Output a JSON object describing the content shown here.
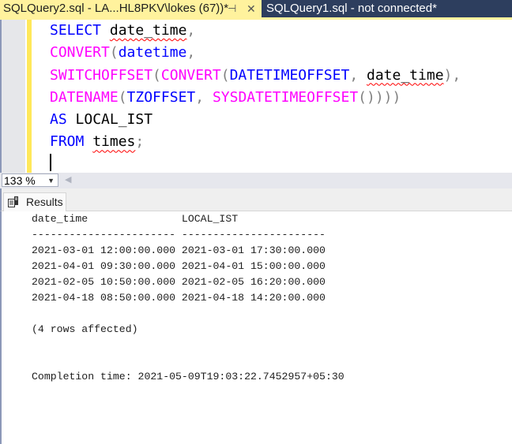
{
  "tabs": [
    {
      "label": "SQLQuery2.sql - LA...HL8PKV\\lokes (67))*",
      "active": true,
      "pin_icon": "pin-icon",
      "close_icon": "close-icon"
    },
    {
      "label": "SQLQuery1.sql - not connected*",
      "active": false
    }
  ],
  "editor": {
    "lines": [
      [
        {
          "t": "SELECT",
          "c": "kw"
        },
        {
          "t": " ",
          "c": "tx"
        },
        {
          "t": "date_time",
          "c": "tx",
          "sq": true
        },
        {
          "t": ",",
          "c": "pn"
        }
      ],
      [
        {
          "t": "CONVERT",
          "c": "fn"
        },
        {
          "t": "(",
          "c": "pn"
        },
        {
          "t": "datetime",
          "c": "kw"
        },
        {
          "t": ",",
          "c": "pn"
        }
      ],
      [
        {
          "t": "SWITCHOFFSET",
          "c": "fn"
        },
        {
          "t": "(",
          "c": "pn"
        },
        {
          "t": "CONVERT",
          "c": "fn"
        },
        {
          "t": "(",
          "c": "pn"
        },
        {
          "t": "DATETIMEOFFSET",
          "c": "kw"
        },
        {
          "t": ", ",
          "c": "pn"
        },
        {
          "t": "date_time",
          "c": "tx",
          "sq": true
        },
        {
          "t": "),",
          "c": "pn"
        }
      ],
      [
        {
          "t": "DATENAME",
          "c": "fn"
        },
        {
          "t": "(",
          "c": "pn"
        },
        {
          "t": "TZOFFSET",
          "c": "kw"
        },
        {
          "t": ", ",
          "c": "pn"
        },
        {
          "t": "SYSDATETIMEOFFSET",
          "c": "fn"
        },
        {
          "t": "())))",
          "c": "pn"
        }
      ],
      [
        {
          "t": "AS",
          "c": "kw"
        },
        {
          "t": " LOCAL_IST",
          "c": "tx"
        }
      ],
      [
        {
          "t": "FROM",
          "c": "kw"
        },
        {
          "t": " ",
          "c": "tx"
        },
        {
          "t": "times",
          "c": "tx",
          "sq": true
        },
        {
          "t": ";",
          "c": "pn"
        }
      ]
    ]
  },
  "zoom": {
    "value": "133 %",
    "arrow_icon": "chevron-down-icon"
  },
  "results_tab": {
    "label": "Results",
    "icon": "results-grid-icon"
  },
  "output": {
    "header": "date_time               LOCAL_IST",
    "separator": "----------------------- -----------------------",
    "columns": [
      "date_time",
      "LOCAL_IST"
    ],
    "rows": [
      [
        "2021-03-01 12:00:00.000",
        "2021-03-01 17:30:00.000"
      ],
      [
        "2021-04-01 09:30:00.000",
        "2021-04-01 15:00:00.000"
      ],
      [
        "2021-02-05 10:50:00.000",
        "2021-02-05 16:20:00.000"
      ],
      [
        "2021-04-18 08:50:00.000",
        "2021-04-18 14:20:00.000"
      ]
    ],
    "rows_text": [
      "2021-03-01 12:00:00.000 2021-03-01 17:30:00.000",
      "2021-04-01 09:30:00.000 2021-04-01 15:00:00.000",
      "2021-02-05 10:50:00.000 2021-02-05 16:20:00.000",
      "2021-04-18 08:50:00.000 2021-04-18 14:20:00.000"
    ],
    "rows_affected": "(4 rows affected)",
    "completion": "Completion time: 2021-05-09T19:03:22.7452957+05:30"
  }
}
